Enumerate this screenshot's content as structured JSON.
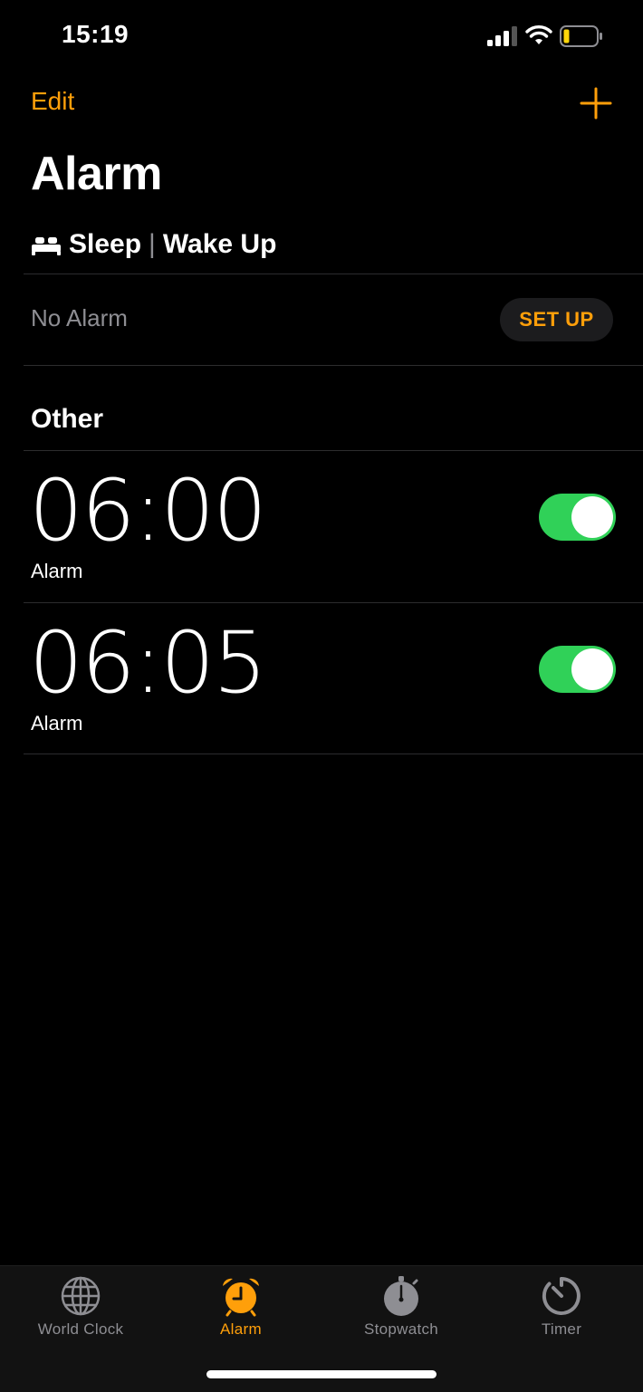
{
  "status_bar": {
    "time": "15:19",
    "signal_icon": "signal-bars-icon",
    "wifi_icon": "wifi-icon",
    "battery_icon": "battery-low-icon"
  },
  "nav": {
    "edit_label": "Edit",
    "add_icon": "plus-icon",
    "title": "Alarm"
  },
  "sleep": {
    "icon": "bed-icon",
    "sleep_label": "Sleep",
    "separator": "|",
    "wake_label": "Wake Up",
    "status": "No Alarm",
    "setup_label": "SET UP"
  },
  "other": {
    "heading": "Other",
    "alarms": [
      {
        "time": "06:00",
        "label": "Alarm",
        "enabled": true
      },
      {
        "time": "06:05",
        "label": "Alarm",
        "enabled": true
      }
    ]
  },
  "tabs": [
    {
      "label": "World Clock",
      "icon": "globe-icon",
      "active": false
    },
    {
      "label": "Alarm",
      "icon": "alarm-clock-icon",
      "active": true
    },
    {
      "label": "Stopwatch",
      "icon": "stopwatch-icon",
      "active": false
    },
    {
      "label": "Timer",
      "icon": "timer-icon",
      "active": false
    }
  ],
  "colors": {
    "accent": "#ff9f0a",
    "toggle_on": "#30d158",
    "secondary_text": "#8e8e93",
    "background": "#000000"
  }
}
